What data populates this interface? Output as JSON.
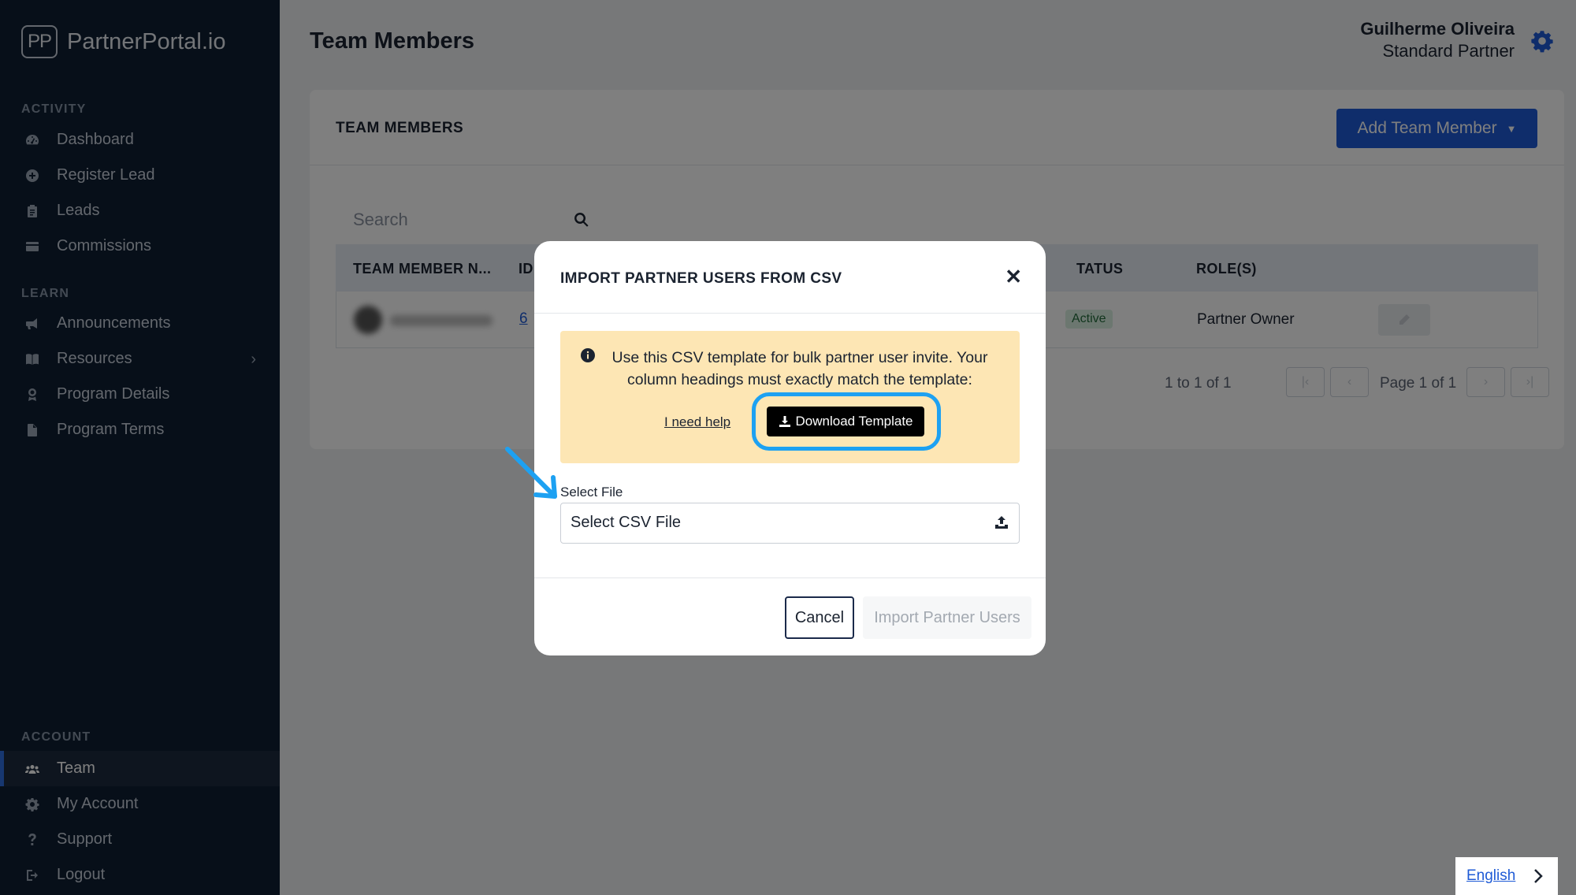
{
  "brand": {
    "logo_mark": "PP",
    "name": "PartnerPortal.io"
  },
  "sidebar": {
    "sections": [
      {
        "label": "ACTIVITY",
        "items": [
          {
            "label": "Dashboard",
            "icon": "dashboard-gauge-icon"
          },
          {
            "label": "Register Lead",
            "icon": "plus-circle-icon"
          },
          {
            "label": "Leads",
            "icon": "clipboard-icon"
          },
          {
            "label": "Commissions",
            "icon": "credit-card-icon"
          }
        ]
      },
      {
        "label": "LEARN",
        "items": [
          {
            "label": "Announcements",
            "icon": "megaphone-icon"
          },
          {
            "label": "Resources",
            "icon": "book-icon",
            "expandable": true
          },
          {
            "label": "Program Details",
            "icon": "award-icon"
          },
          {
            "label": "Program Terms",
            "icon": "file-icon"
          }
        ]
      },
      {
        "label": "ACCOUNT",
        "items": [
          {
            "label": "Team",
            "icon": "users-icon",
            "active": true
          },
          {
            "label": "My Account",
            "icon": "gear-icon"
          },
          {
            "label": "Support",
            "icon": "question-icon"
          },
          {
            "label": "Logout",
            "icon": "logout-icon"
          }
        ]
      }
    ]
  },
  "header": {
    "title": "Team Members",
    "user_name": "Guilherme Oliveira",
    "user_role": "Standard Partner"
  },
  "card": {
    "title": "TEAM MEMBERS",
    "add_button": "Add Team Member",
    "search_placeholder": "Search",
    "columns": [
      "TEAM MEMBER N...",
      "ID",
      "STATUS",
      "ROLE(S)"
    ],
    "columns_visible": [
      "TEAM MEMBER N...",
      "ID",
      "TATUS",
      "ROLE(S)"
    ],
    "rows": [
      {
        "id": "6",
        "status": "Active",
        "role": "Partner Owner"
      }
    ],
    "pager": {
      "count": "1 to 1 of 1",
      "page": "Page 1 of 1"
    }
  },
  "modal": {
    "title": "IMPORT PARTNER USERS FROM CSV",
    "notice": "Use this CSV template for bulk partner user invite. Your column headings must exactly match the template:",
    "help_link": "I need help",
    "download_button": "Download Template",
    "file_label": "Select File",
    "file_placeholder": "Select CSV File",
    "cancel_button": "Cancel",
    "import_button": "Import Partner Users"
  },
  "language": {
    "label": "English"
  },
  "colors": {
    "sidebar": "#0f1f33",
    "accent": "#1f5bd6",
    "highlight": "#1da1f2",
    "notice_bg": "#fde6b4"
  }
}
